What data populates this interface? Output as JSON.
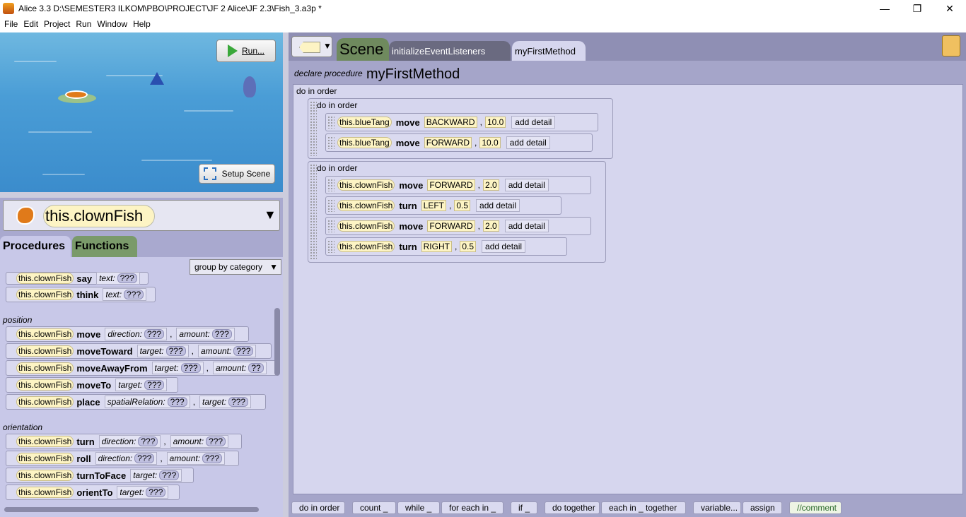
{
  "window": {
    "title": "Alice  3.3 D:\\SEMESTER3 ILKOM\\PBO\\PROJECT\\JF 2 Alice\\JF 2.3\\Fish_3.a3p *",
    "minimize": "—",
    "maximize": "❐",
    "close": "✕"
  },
  "menu": [
    "File",
    "Edit",
    "Project",
    "Run",
    "Window",
    "Help"
  ],
  "scene": {
    "run_label": "Run...",
    "setup_label": "Setup Scene"
  },
  "object_selector": {
    "value": "this.clownFish",
    "arrow": "▼"
  },
  "left_tabs": {
    "procedures": "Procedures",
    "functions": "Functions"
  },
  "group_by": {
    "value": "group by category",
    "arrow": "▼"
  },
  "procedures": {
    "top_rows": [
      {
        "target": "this.clownFish",
        "name": "say",
        "params": [
          {
            "label": "text:",
            "value": "???"
          }
        ]
      },
      {
        "target": "this.clownFish",
        "name": "think",
        "params": [
          {
            "label": "text:",
            "value": "???"
          }
        ]
      }
    ],
    "position_label": "position",
    "position": [
      {
        "target": "this.clownFish",
        "name": "move",
        "params": [
          {
            "label": "direction:",
            "value": "???"
          },
          {
            "label": "amount:",
            "value": "???"
          }
        ]
      },
      {
        "target": "this.clownFish",
        "name": "moveToward",
        "params": [
          {
            "label": "target:",
            "value": "???"
          },
          {
            "label": "amount:",
            "value": "???"
          }
        ]
      },
      {
        "target": "this.clownFish",
        "name": "moveAwayFrom",
        "params": [
          {
            "label": "target:",
            "value": "???"
          },
          {
            "label": "amount:",
            "value": "??"
          }
        ]
      },
      {
        "target": "this.clownFish",
        "name": "moveTo",
        "params": [
          {
            "label": "target:",
            "value": "???"
          }
        ]
      },
      {
        "target": "this.clownFish",
        "name": "place",
        "params": [
          {
            "label": "spatialRelation:",
            "value": "???"
          },
          {
            "label": "target:",
            "value": "???"
          }
        ]
      }
    ],
    "orientation_label": "orientation",
    "orientation": [
      {
        "target": "this.clownFish",
        "name": "turn",
        "params": [
          {
            "label": "direction:",
            "value": "???"
          },
          {
            "label": "amount:",
            "value": "???"
          }
        ]
      },
      {
        "target": "this.clownFish",
        "name": "roll",
        "params": [
          {
            "label": "direction:",
            "value": "???"
          },
          {
            "label": "amount:",
            "value": "???"
          }
        ]
      },
      {
        "target": "this.clownFish",
        "name": "turnToFace",
        "params": [
          {
            "label": "target:",
            "value": "???"
          }
        ]
      },
      {
        "target": "this.clownFish",
        "name": "orientTo",
        "params": [
          {
            "label": "target:",
            "value": "???"
          }
        ]
      }
    ]
  },
  "editor_tabs": {
    "scene": "Scene",
    "init": "initializeEventListeners",
    "method": "myFirstMethod"
  },
  "code": {
    "declare": "declare procedure",
    "method_name": "myFirstMethod",
    "outer_label": "do in order",
    "blocks": [
      {
        "label": "do in order",
        "statements": [
          {
            "target": "this.blueTang",
            "verb": "move",
            "arg1": "BACKWARD",
            "arg2": "10.0",
            "detail": "add detail"
          },
          {
            "target": "this.blueTang",
            "verb": "move",
            "arg1": "FORWARD",
            "arg2": "10.0",
            "detail": "add detail"
          }
        ]
      },
      {
        "label": "do in order",
        "statements": [
          {
            "target": "this.clownFish",
            "verb": "move",
            "arg1": "FORWARD",
            "arg2": "2.0",
            "detail": "add detail"
          },
          {
            "target": "this.clownFish",
            "verb": "turn",
            "arg1": "LEFT",
            "arg2": "0.5",
            "detail": "add detail"
          },
          {
            "target": "this.clownFish",
            "verb": "move",
            "arg1": "FORWARD",
            "arg2": "2.0",
            "detail": "add detail"
          },
          {
            "target": "this.clownFish",
            "verb": "turn",
            "arg1": "RIGHT",
            "arg2": "0.5",
            "detail": "add detail"
          }
        ]
      }
    ]
  },
  "toolbox": [
    "do in order",
    "count _",
    "while _",
    "for each in _",
    "if _",
    "do together",
    "each in _ together",
    "variable...",
    "assign",
    "//comment"
  ]
}
